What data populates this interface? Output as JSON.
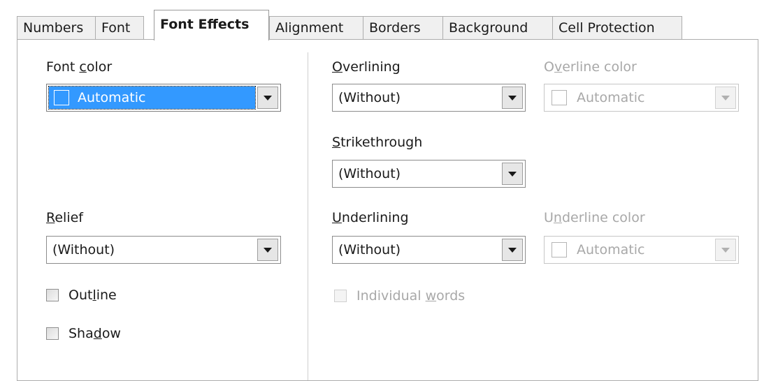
{
  "tabs": [
    {
      "label": "Numbers"
    },
    {
      "label": "Font"
    },
    {
      "label": "Font Effects",
      "active": true
    },
    {
      "label": "Alignment"
    },
    {
      "label": "Borders"
    },
    {
      "label": "Background"
    },
    {
      "label": "Cell Protection"
    }
  ],
  "font_color": {
    "label_pre": "Font ",
    "label_key": "c",
    "label_post": "olor",
    "value": "Automatic",
    "swatch_color": "#3399ff"
  },
  "relief": {
    "label_key": "R",
    "label_post": "elief",
    "value": "(Without)"
  },
  "outline": {
    "label_pre": "Out",
    "label_key": "l",
    "label_post": "ine",
    "checked": false
  },
  "shadow": {
    "label_pre": "Sha",
    "label_key": "d",
    "label_post": "ow",
    "checked": false
  },
  "overlining": {
    "label_key": "O",
    "label_post": "verlining",
    "value": "(Without)"
  },
  "overline_color": {
    "label_pre": "O",
    "label_key": "v",
    "label_post": "erline color",
    "value": "Automatic",
    "enabled": false
  },
  "strikethrough": {
    "label_key": "S",
    "label_post": "trikethrough",
    "value": "(Without)"
  },
  "underlining": {
    "label_key": "U",
    "label_post": "nderlining",
    "value": "(Without)"
  },
  "underline_color": {
    "label_pre": "U",
    "label_key": "n",
    "label_post": "derline color",
    "value": "Automatic",
    "enabled": false
  },
  "individual_words": {
    "label_pre": "Individual ",
    "label_key": "w",
    "label_post": "ords",
    "checked": false,
    "enabled": false
  }
}
